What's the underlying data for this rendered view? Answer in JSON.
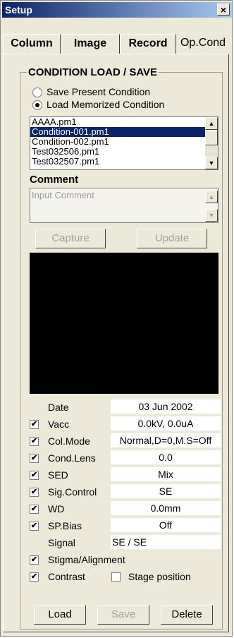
{
  "window": {
    "title": "Setup",
    "close_glyph": "×"
  },
  "tabs": [
    {
      "label": "Column"
    },
    {
      "label": "Image"
    },
    {
      "label": "Record"
    },
    {
      "label": "Op.Cond",
      "active": true
    }
  ],
  "group_title": "CONDITION LOAD / SAVE",
  "radios": {
    "save_present": {
      "label": "Save Present Condition",
      "selected": false
    },
    "load_memorized": {
      "label": "Load Memorized Condition",
      "selected": true
    }
  },
  "file_list": {
    "items": [
      "AAAA.pm1",
      "Condition-001.pm1",
      "Condition-002.pm1",
      "Test032506.pm1",
      "Test032507.pm1"
    ],
    "selected_index": 1
  },
  "comment": {
    "label": "Comment",
    "placeholder": "Input Comment"
  },
  "buttons": {
    "capture": "Capture",
    "update": "Update",
    "load": "Load",
    "save": "Save",
    "delete": "Delete"
  },
  "params": {
    "date": {
      "label": "Date",
      "value": "03 Jun 2002"
    },
    "vacc": {
      "label": "Vacc",
      "value": "0.0kV, 0.0uA",
      "checked": true
    },
    "col_mode": {
      "label": "Col.Mode",
      "value": "Normal,D=0,M.S=Off",
      "checked": true
    },
    "cond_lens": {
      "label": "Cond.Lens",
      "value": "0.0",
      "checked": true
    },
    "sed": {
      "label": "SED",
      "value": "Mix",
      "checked": true
    },
    "sig_control": {
      "label": "Sig.Control",
      "value": "SE",
      "checked": true
    },
    "wd": {
      "label": "WD",
      "value": "0.0mm",
      "checked": true
    },
    "sp_bias": {
      "label": "SP.Bias",
      "value": "Off",
      "checked": true
    },
    "signal": {
      "label": "Signal",
      "value": "SE / SE"
    }
  },
  "options": {
    "stigma": {
      "label": "Stigma/Alignment",
      "checked": true
    },
    "contrast": {
      "label": "Contrast",
      "checked": true
    },
    "stage_position": {
      "label": "Stage position",
      "checked": false
    }
  },
  "glyphs": {
    "check": "✔",
    "up": "▲",
    "down": "▼"
  }
}
